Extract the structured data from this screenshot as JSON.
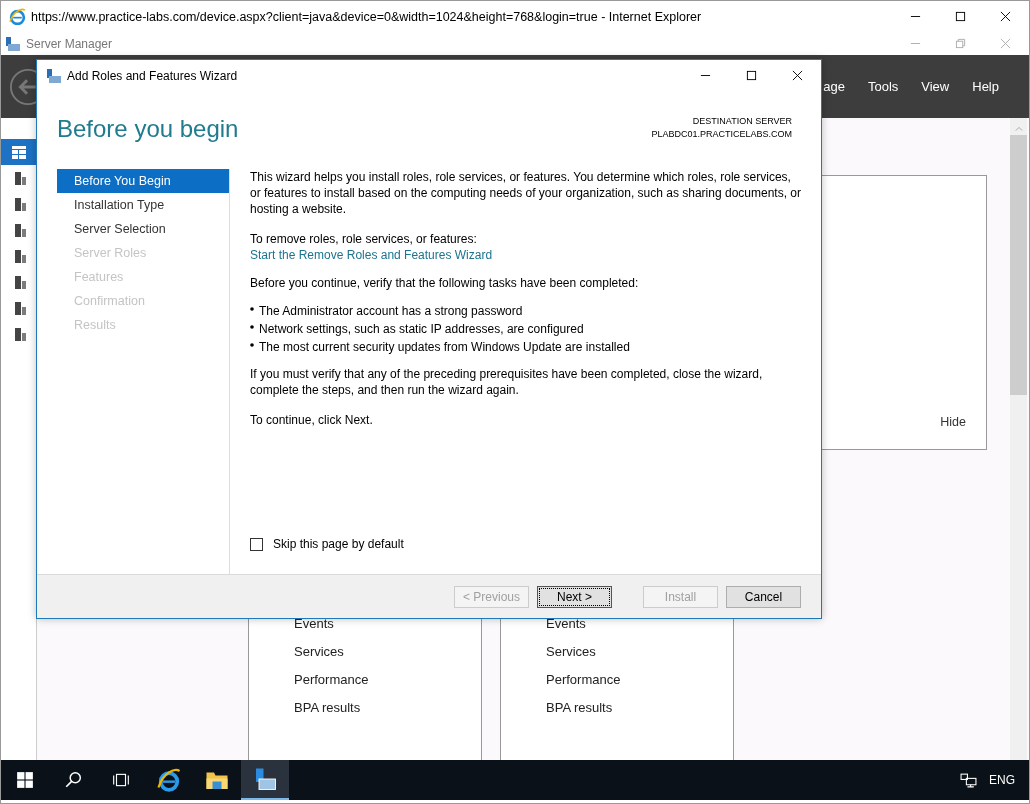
{
  "browser": {
    "title": "https://www.practice-labs.com/device.aspx?client=java&device=0&width=1024&height=768&login=true - Internet Explorer"
  },
  "server_manager": {
    "title": "Server Manager",
    "menu": [
      "age",
      "Tools",
      "View",
      "Help"
    ],
    "nav": [
      {
        "selected": true
      },
      {
        "selected": false
      },
      {
        "selected": false
      },
      {
        "selected": false
      },
      {
        "selected": false
      },
      {
        "selected": false
      },
      {
        "selected": false
      },
      {
        "selected": false
      }
    ],
    "panel": {
      "hide_link": "Hide"
    },
    "tiles": [
      {
        "items": [
          "Events",
          "Services",
          "Performance",
          "BPA results"
        ]
      },
      {
        "items": [
          "Events",
          "Services",
          "Performance",
          "BPA results"
        ]
      }
    ]
  },
  "wizard": {
    "title": "Add Roles and Features Wizard",
    "heading": "Before you begin",
    "destination_label": "DESTINATION SERVER",
    "destination_server": "PLABDC01.PRACTICELABS.COM",
    "steps": [
      {
        "label": "Before You Begin",
        "selected": true,
        "disabled": false
      },
      {
        "label": "Installation Type",
        "selected": false,
        "disabled": false
      },
      {
        "label": "Server Selection",
        "selected": false,
        "disabled": false
      },
      {
        "label": "Server Roles",
        "selected": false,
        "disabled": true
      },
      {
        "label": "Features",
        "selected": false,
        "disabled": true
      },
      {
        "label": "Confirmation",
        "selected": false,
        "disabled": true
      },
      {
        "label": "Results",
        "selected": false,
        "disabled": true
      }
    ],
    "intro": "This wizard helps you install roles, role services, or features. You determine which roles, role services, or features to install based on the computing needs of your organization, such as sharing documents, or hosting a website.",
    "remove_label": "To remove roles, role services, or features:",
    "remove_link": "Start the Remove Roles and Features Wizard",
    "tasks_intro": "Before you continue, verify that the following tasks have been completed:",
    "tasks": [
      "The Administrator account has a strong password",
      "Network settings, such as static IP addresses, are configured",
      "The most current security updates from Windows Update are installed"
    ],
    "verify_text": "If you must verify that any of the preceding prerequisites have been completed, close the wizard, complete the steps, and then run the wizard again.",
    "continue_text": "To continue, click Next.",
    "skip": {
      "label": "Skip this page by default",
      "checked": false
    },
    "buttons": [
      {
        "label": "< Previous",
        "disabled": true,
        "focused": false
      },
      {
        "label": "Next >",
        "disabled": false,
        "focused": true
      },
      {
        "label": "Install",
        "disabled": true,
        "focused": false
      },
      {
        "label": "Cancel",
        "disabled": false,
        "focused": false
      }
    ]
  },
  "taskbar": {
    "apps": [
      {
        "kind": "start",
        "selected": false
      },
      {
        "kind": "search",
        "selected": false
      },
      {
        "kind": "taskview",
        "selected": false
      },
      {
        "kind": "browser",
        "selected": false
      },
      {
        "kind": "folder",
        "selected": false
      },
      {
        "kind": "server",
        "selected": true
      }
    ],
    "language": "ENG"
  }
}
